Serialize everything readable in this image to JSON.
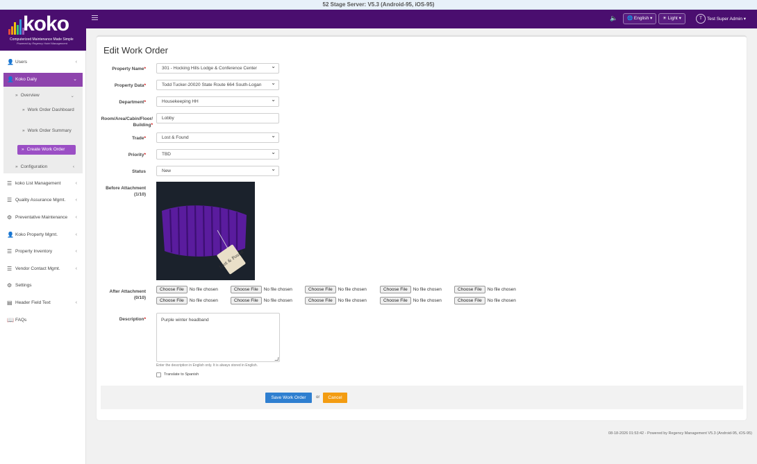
{
  "topbar": {
    "title": "52 Stage Server: V5.3 (Android-95, iOS-95)"
  },
  "navbar": {
    "language": "English",
    "theme": "Light",
    "user_initial": "T",
    "user_name": "Test Super Admin"
  },
  "logo": {
    "word": "koko",
    "tagline": "Computerized Maintenance Made Simple",
    "powered": "Powered by Regency Hotel Management"
  },
  "sidebar": {
    "users": "Users",
    "koko_daily": "Koko Daily",
    "overview": "Overview",
    "work_order_dashboard": "Work Order Dashboard",
    "work_order_summary": "Work Order Summary",
    "create_work_order": "Create Work Order",
    "configuration": "Configuration",
    "koko_list_management": "koko List Management",
    "quality_assurance": "Quality Assurance Mgmt.",
    "preventative_maintenance": "Preventative Maintenance",
    "koko_property_mgmt": "Koko Property Mgmt.",
    "property_inventory": "Property Inventory",
    "vendor_contact": "Vendor Contact Mgmt.",
    "settings": "Settings",
    "header_field_text": "Header Field Text",
    "faqs": "FAQs"
  },
  "form": {
    "title": "Edit Work Order",
    "property_name_label": "Property Name",
    "property_name_value": "301 - Hocking Hills Lodge & Conference Center",
    "property_data_label": "Property Data",
    "property_data_value": "Todd Tucker-20020 State Route 664 South-Logan",
    "department_label": "Department",
    "department_value": "Housekeeping HH",
    "room_label_1": "Room/Area/Cabin/Floor/",
    "room_label_2": "Building",
    "room_value": "Lobby",
    "trade_label": "Trade",
    "trade_value": "Lost & Found",
    "priority_label": "Priority",
    "priority_value": "TBD",
    "status_label": "Status",
    "status_value": "New",
    "before_attachment_label": "Before Attachment",
    "before_attachment_count": "(1/10)",
    "tag_text": "Lost & Found",
    "after_attachment_label": "After Attachment",
    "after_attachment_count": "(0/10)",
    "choose_file": "Choose File",
    "no_file": "No file chosen",
    "description_label": "Description",
    "description_value": "Purple winter headband",
    "description_help": "Enter the description in English only. It is always stored in English.",
    "translate_label": "Translate to Spanish",
    "required_mark": "*",
    "save_button": "Save Work Order",
    "or_text": "or",
    "cancel_button": "Cancel"
  },
  "footer": {
    "text": "08-18-2026 01:53:42 - Powered by Regency Management V5.3 (Android-95, iOS-95)"
  },
  "colors": {
    "navbar": "#4a0e6f",
    "sidebar_active": "#8e44ad",
    "create_button": "#9b4fc5",
    "save_button": "#2f7fd0",
    "cancel_button": "#f39c12"
  }
}
